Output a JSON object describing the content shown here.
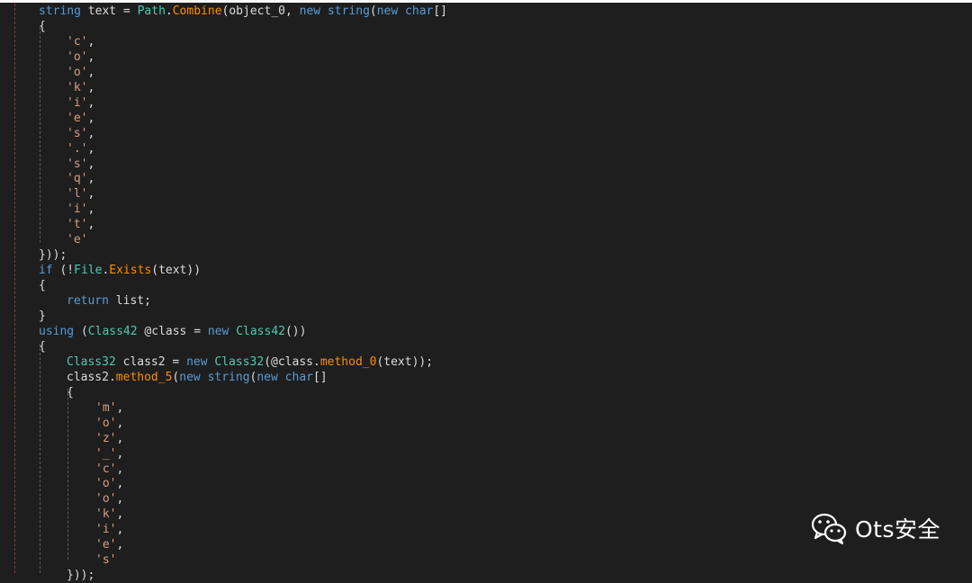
{
  "watermark": {
    "text": "Ots安全",
    "icon": "wechat-icon"
  },
  "colors": {
    "background": "#1e1e1e",
    "keyword": "#569cd6",
    "type": "#4ec9b0",
    "method": "#ff8c00",
    "string": "#d69d85",
    "text": "#dcdcdc"
  },
  "code": {
    "lines": [
      [
        [
          "kw",
          "string"
        ],
        [
          "pl",
          " text = "
        ],
        [
          "ty",
          "Path"
        ],
        [
          "pl",
          "."
        ],
        [
          "mo",
          "Combine"
        ],
        [
          "pl",
          "(object_0, "
        ],
        [
          "kw",
          "new"
        ],
        [
          "pl",
          " "
        ],
        [
          "kw",
          "string"
        ],
        [
          "pl",
          "("
        ],
        [
          "kw",
          "new"
        ],
        [
          "pl",
          " "
        ],
        [
          "kw",
          "char"
        ],
        [
          "pl",
          "[]"
        ]
      ],
      [
        [
          "pl",
          "{"
        ]
      ],
      [
        [
          "st",
          "'c'"
        ],
        [
          "pl",
          ","
        ]
      ],
      [
        [
          "st",
          "'o'"
        ],
        [
          "pl",
          ","
        ]
      ],
      [
        [
          "st",
          "'o'"
        ],
        [
          "pl",
          ","
        ]
      ],
      [
        [
          "st",
          "'k'"
        ],
        [
          "pl",
          ","
        ]
      ],
      [
        [
          "st",
          "'i'"
        ],
        [
          "pl",
          ","
        ]
      ],
      [
        [
          "st",
          "'e'"
        ],
        [
          "pl",
          ","
        ]
      ],
      [
        [
          "st",
          "'s'"
        ],
        [
          "pl",
          ","
        ]
      ],
      [
        [
          "st",
          "'.'"
        ],
        [
          "pl",
          ","
        ]
      ],
      [
        [
          "st",
          "'s'"
        ],
        [
          "pl",
          ","
        ]
      ],
      [
        [
          "st",
          "'q'"
        ],
        [
          "pl",
          ","
        ]
      ],
      [
        [
          "st",
          "'l'"
        ],
        [
          "pl",
          ","
        ]
      ],
      [
        [
          "st",
          "'i'"
        ],
        [
          "pl",
          ","
        ]
      ],
      [
        [
          "st",
          "'t'"
        ],
        [
          "pl",
          ","
        ]
      ],
      [
        [
          "st",
          "'e'"
        ]
      ],
      [
        [
          "pl",
          "}));"
        ]
      ],
      [
        [
          "kw",
          "if"
        ],
        [
          "pl",
          " (!"
        ],
        [
          "ty",
          "File"
        ],
        [
          "pl",
          "."
        ],
        [
          "mo",
          "Exists"
        ],
        [
          "pl",
          "(text))"
        ]
      ],
      [
        [
          "pl",
          "{"
        ]
      ],
      [
        [
          "kw",
          "return"
        ],
        [
          "pl",
          " list;"
        ]
      ],
      [
        [
          "pl",
          "}"
        ]
      ],
      [
        [
          "kw",
          "using"
        ],
        [
          "pl",
          " ("
        ],
        [
          "ty",
          "Class42"
        ],
        [
          "pl",
          " @class = "
        ],
        [
          "kw",
          "new"
        ],
        [
          "pl",
          " "
        ],
        [
          "ty",
          "Class42"
        ],
        [
          "pl",
          "())"
        ]
      ],
      [
        [
          "pl",
          "{"
        ]
      ],
      [
        [
          "ty",
          "Class32"
        ],
        [
          "pl",
          " class2 = "
        ],
        [
          "kw",
          "new"
        ],
        [
          "pl",
          " "
        ],
        [
          "ty",
          "Class32"
        ],
        [
          "pl",
          "(@class."
        ],
        [
          "mo",
          "method_0"
        ],
        [
          "pl",
          "(text));"
        ]
      ],
      [
        [
          "pl",
          "class2."
        ],
        [
          "mo",
          "method_5"
        ],
        [
          "pl",
          "("
        ],
        [
          "kw",
          "new"
        ],
        [
          "pl",
          " "
        ],
        [
          "kw",
          "string"
        ],
        [
          "pl",
          "("
        ],
        [
          "kw",
          "new"
        ],
        [
          "pl",
          " "
        ],
        [
          "kw",
          "char"
        ],
        [
          "pl",
          "[]"
        ]
      ],
      [
        [
          "pl",
          "{"
        ]
      ],
      [
        [
          "st",
          "'m'"
        ],
        [
          "pl",
          ","
        ]
      ],
      [
        [
          "st",
          "'o'"
        ],
        [
          "pl",
          ","
        ]
      ],
      [
        [
          "st",
          "'z'"
        ],
        [
          "pl",
          ","
        ]
      ],
      [
        [
          "st",
          "'_'"
        ],
        [
          "pl",
          ","
        ]
      ],
      [
        [
          "st",
          "'c'"
        ],
        [
          "pl",
          ","
        ]
      ],
      [
        [
          "st",
          "'o'"
        ],
        [
          "pl",
          ","
        ]
      ],
      [
        [
          "st",
          "'o'"
        ],
        [
          "pl",
          ","
        ]
      ],
      [
        [
          "st",
          "'k'"
        ],
        [
          "pl",
          ","
        ]
      ],
      [
        [
          "st",
          "'i'"
        ],
        [
          "pl",
          ","
        ]
      ],
      [
        [
          "st",
          "'e'"
        ],
        [
          "pl",
          ","
        ]
      ],
      [
        [
          "st",
          "'s'"
        ]
      ],
      [
        [
          "pl",
          "}));"
        ]
      ]
    ]
  }
}
